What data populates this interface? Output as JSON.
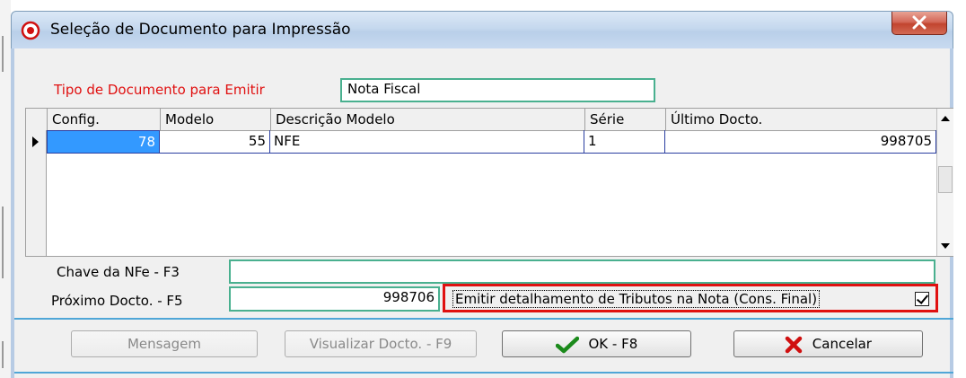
{
  "window": {
    "title": "Seleção de Documento para Impressão"
  },
  "form": {
    "tipo_label": "Tipo de Documento para Emitir",
    "tipo_value": "Nota Fiscal"
  },
  "grid": {
    "columns": [
      "Config.",
      "Modelo",
      "Descrição Modelo",
      "Série",
      "Último Docto."
    ],
    "rows": [
      {
        "config": "78",
        "modelo": "55",
        "descricao": "NFE",
        "serie": "1",
        "ultimo": "998705"
      }
    ]
  },
  "chave": {
    "label": "Chave da NFe - F3",
    "value": ""
  },
  "proximo": {
    "label": "Próximo Docto. - F5",
    "value": "998706"
  },
  "detalhamento": {
    "label": "Emitir detalhamento de Tributos na Nota (Cons. Final)",
    "checked": true
  },
  "buttons": {
    "mensagem": "Mensagem",
    "visualizar": "Visualizar Docto. - F9",
    "ok": "OK - F8",
    "cancelar": "Cancelar"
  },
  "colors": {
    "accent_border": "#49b08f",
    "highlight_red": "#e01010",
    "selection_blue": "#3399ff"
  }
}
